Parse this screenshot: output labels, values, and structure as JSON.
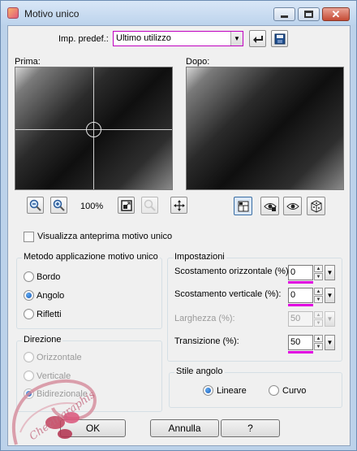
{
  "window": {
    "title": "Motivo unico"
  },
  "preset": {
    "label": "Imp. predef.:",
    "value": "Ultimo utilizzo"
  },
  "preview": {
    "before_label": "Prima:",
    "after_label": "Dopo:",
    "zoom": "100%"
  },
  "options": {
    "show_preview_label": "Visualizza anteprima motivo unico"
  },
  "method": {
    "title": "Metodo applicazione motivo unico",
    "items": [
      {
        "label": "Bordo",
        "selected": false
      },
      {
        "label": "Angolo",
        "selected": true
      },
      {
        "label": "Rifletti",
        "selected": false
      }
    ]
  },
  "direction": {
    "title": "Direzione",
    "items": [
      {
        "label": "Orizzontale",
        "selected": false
      },
      {
        "label": "Verticale",
        "selected": false
      },
      {
        "label": "Bidirezionale",
        "selected": true
      }
    ]
  },
  "settings": {
    "title": "Impostazioni",
    "h_offset_label": "Scostamento orizzontale (%):",
    "h_offset": "0",
    "v_offset_label": "Scostamento verticale (%):",
    "v_offset": "0",
    "width_label": "Larghezza (%):",
    "width": "50",
    "transition_label": "Transizione (%):",
    "transition": "50"
  },
  "corner_style": {
    "title": "Stile angolo",
    "linear_label": "Lineare",
    "linear_selected": true,
    "curved_label": "Curvo",
    "curved_selected": false
  },
  "buttons": {
    "ok": "OK",
    "cancel": "Annulla",
    "help": "?"
  },
  "watermark": {
    "text": "Chezingraphis"
  },
  "colors": {
    "accent_underline": "#e000e0",
    "title_bar": "#bcd3ec"
  }
}
